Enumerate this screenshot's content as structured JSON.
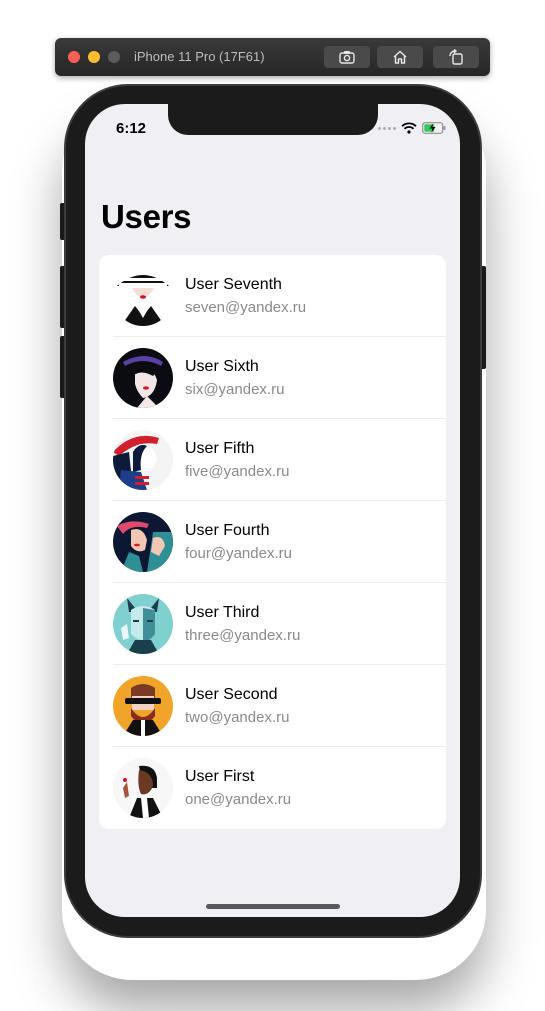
{
  "simulator": {
    "title": "iPhone 11 Pro (17F61)",
    "buttons": [
      "camera-icon",
      "home-icon",
      "rotate-icon"
    ]
  },
  "status_bar": {
    "time": "6:12"
  },
  "page": {
    "title": "Users"
  },
  "users": [
    {
      "name": "User Seventh",
      "email": "seven@yandex.ru",
      "avatar": "woman-striped-hat"
    },
    {
      "name": "User Sixth",
      "email": "six@yandex.ru",
      "avatar": "woman-dark-hair"
    },
    {
      "name": "User Fifth",
      "email": "five@yandex.ru",
      "avatar": "woman-red-hat"
    },
    {
      "name": "User Fourth",
      "email": "four@yandex.ru",
      "avatar": "woman-teal"
    },
    {
      "name": "User Third",
      "email": "three@yandex.ru",
      "avatar": "woman-teal-portrait"
    },
    {
      "name": "User Second",
      "email": "two@yandex.ru",
      "avatar": "man-beard-sunglasses"
    },
    {
      "name": "User First",
      "email": "one@yandex.ru",
      "avatar": "man-dark-skin"
    }
  ]
}
